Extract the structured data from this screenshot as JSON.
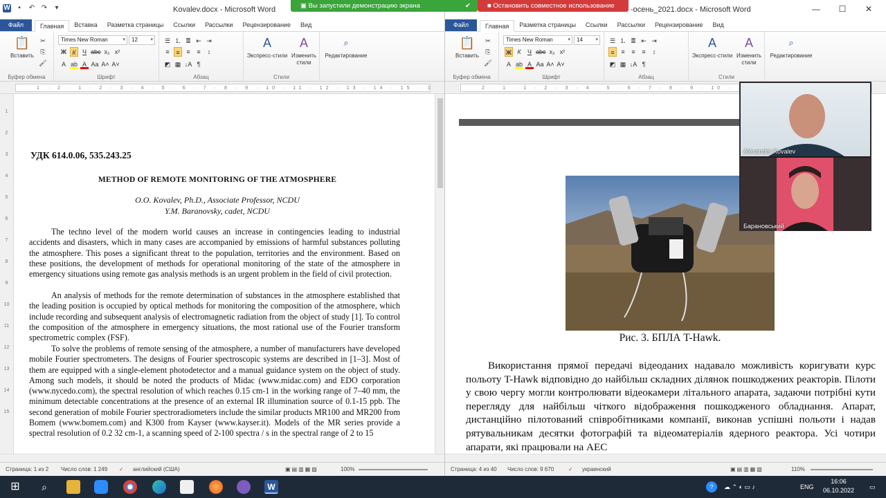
{
  "share_banner": {
    "demo_text": "Вы запустили демонстрацию экрана",
    "stop_text": "Остановить совместное использование"
  },
  "left": {
    "title": "Kovalev.docx - Microsoft Word",
    "tabs": [
      "Файл",
      "Главная",
      "Вставка",
      "Разметка страницы",
      "Ссылки",
      "Рассылки",
      "Рецензирование",
      "Вид"
    ],
    "ribbon": {
      "paste": "Вставить",
      "font": "Times New Roman",
      "size": "12",
      "express": "Экспресс-стили",
      "change1": "Изменить",
      "change2": "стили",
      "edit": "Редактирование",
      "groups": [
        "Буфер обмена",
        "Шрифт",
        "Абзац",
        "Стили"
      ]
    },
    "doc": {
      "udk": "УДК 614.0.06, 535.243.25",
      "title": "METHOD OF REMOTE MONITORING OF THE ATMOSPHERE",
      "author1": "O.O. Kovalev, Ph.D., Associate Professor, NCDU",
      "author2": "Y.M. Baranovsky, cadet, NCDU",
      "p1": "The techno level of the modern world causes an increase in contingencies leading to industrial accidents and disasters, which in many cases are accompanied by emissions of harmful substances polluting the atmosphere. This poses a significant threat to the population, territories and the environment. Based on these positions, the development of methods for operational monitoring of the state of the atmosphere in emergency situations using remote gas analysis methods is an urgent problem in the field of civil protection.",
      "p2": "An analysis of methods for the remote determination of substances in the atmosphere established that the leading position is occupied by optical methods for monitoring the composition of the atmosphere, which include recording and subsequent analysis of electromagnetic radiation from the object of study [1]. To control the composition of the atmosphere in emergency situations, the most rational use of the Fourier transform spectrometric complex (FSF).",
      "p3": "To solve the problems of remote sensing of the atmosphere, a number of manufacturers have developed mobile Fourier spectrometers. The designs of Fourier spectroscopic systems are described in [1–3]. Most of them are equipped with a single-element photodetector and a manual guidance system on the object of study. Among such models, it should be noted the products of Midac (www.midac.com) and EDO corporation (www.nycedo.com), the spectral resolution of which reaches 0.15 cm-1 in the working range of 7–40 mm, the minimum detectable concentrations at the presence of an external IR illumination source of 0.1-15 ppb. The second generation of mobile Fourier spectroradiometers include the similar products MR100 and MR200 from Bomem (www.bomem.com) and K300 from Kayser (www.kayser.it). Models of the MR series provide a spectral resolution of 0.2 32 cm-1, a scanning speed of 2-100 spectra / s in the spectral range of 2 to 15"
    },
    "status": {
      "page": "Страница: 1 из 2",
      "words": "Число слов: 1 249",
      "lang": "английский (США)",
      "zoom": "100%"
    }
  },
  "right": {
    "title": "-осень_2021.docx - Microsoft Word",
    "tabs": [
      "Файл",
      "Главная",
      "Разметка страницы",
      "Ссылки",
      "Рассылки",
      "Рецензирование",
      "Вид"
    ],
    "ribbon": {
      "paste": "Вставить",
      "font": "Times New Roman",
      "size": "14",
      "express": "Экспресс-стили",
      "change1": "Изменить",
      "change2": "стили",
      "edit": "Редактирование",
      "groups": [
        "Буфер обмена",
        "Шрифт",
        "Абзац",
        "Стили"
      ]
    },
    "doc": {
      "caption": "Рис. 3. БПЛА T-Hawk.",
      "body": "Використання прямої передачі відеоданих надавало можливість коригувати курс польоту T-Hawk відповідно до найбільш складних ділянок пошкоджених реакторів. Пілоти у свою чергу могли контролювати відеокамери літального апарата, задаючи потрібні кути перегляду для найбільш чіткого відображення пошкодженого обладнання. Апарат, дистанційно пілотований співробітниками компанії, виконав успішні польоти і надав рятувальникам десятки фотографій та відеоматеріалів ядерного реактора. Усі чотири апарати, які працювали на АЕС"
    },
    "status": {
      "page": "Страница: 4 из 40",
      "words": "Число слов: 9 670",
      "lang": "украинский",
      "zoom": "110%"
    }
  },
  "video": {
    "p1": "Alexander Kovalev",
    "p2": "Барановський"
  },
  "taskbar": {
    "lang": "ENG",
    "time": "16:06",
    "date": "06.10.2022"
  }
}
